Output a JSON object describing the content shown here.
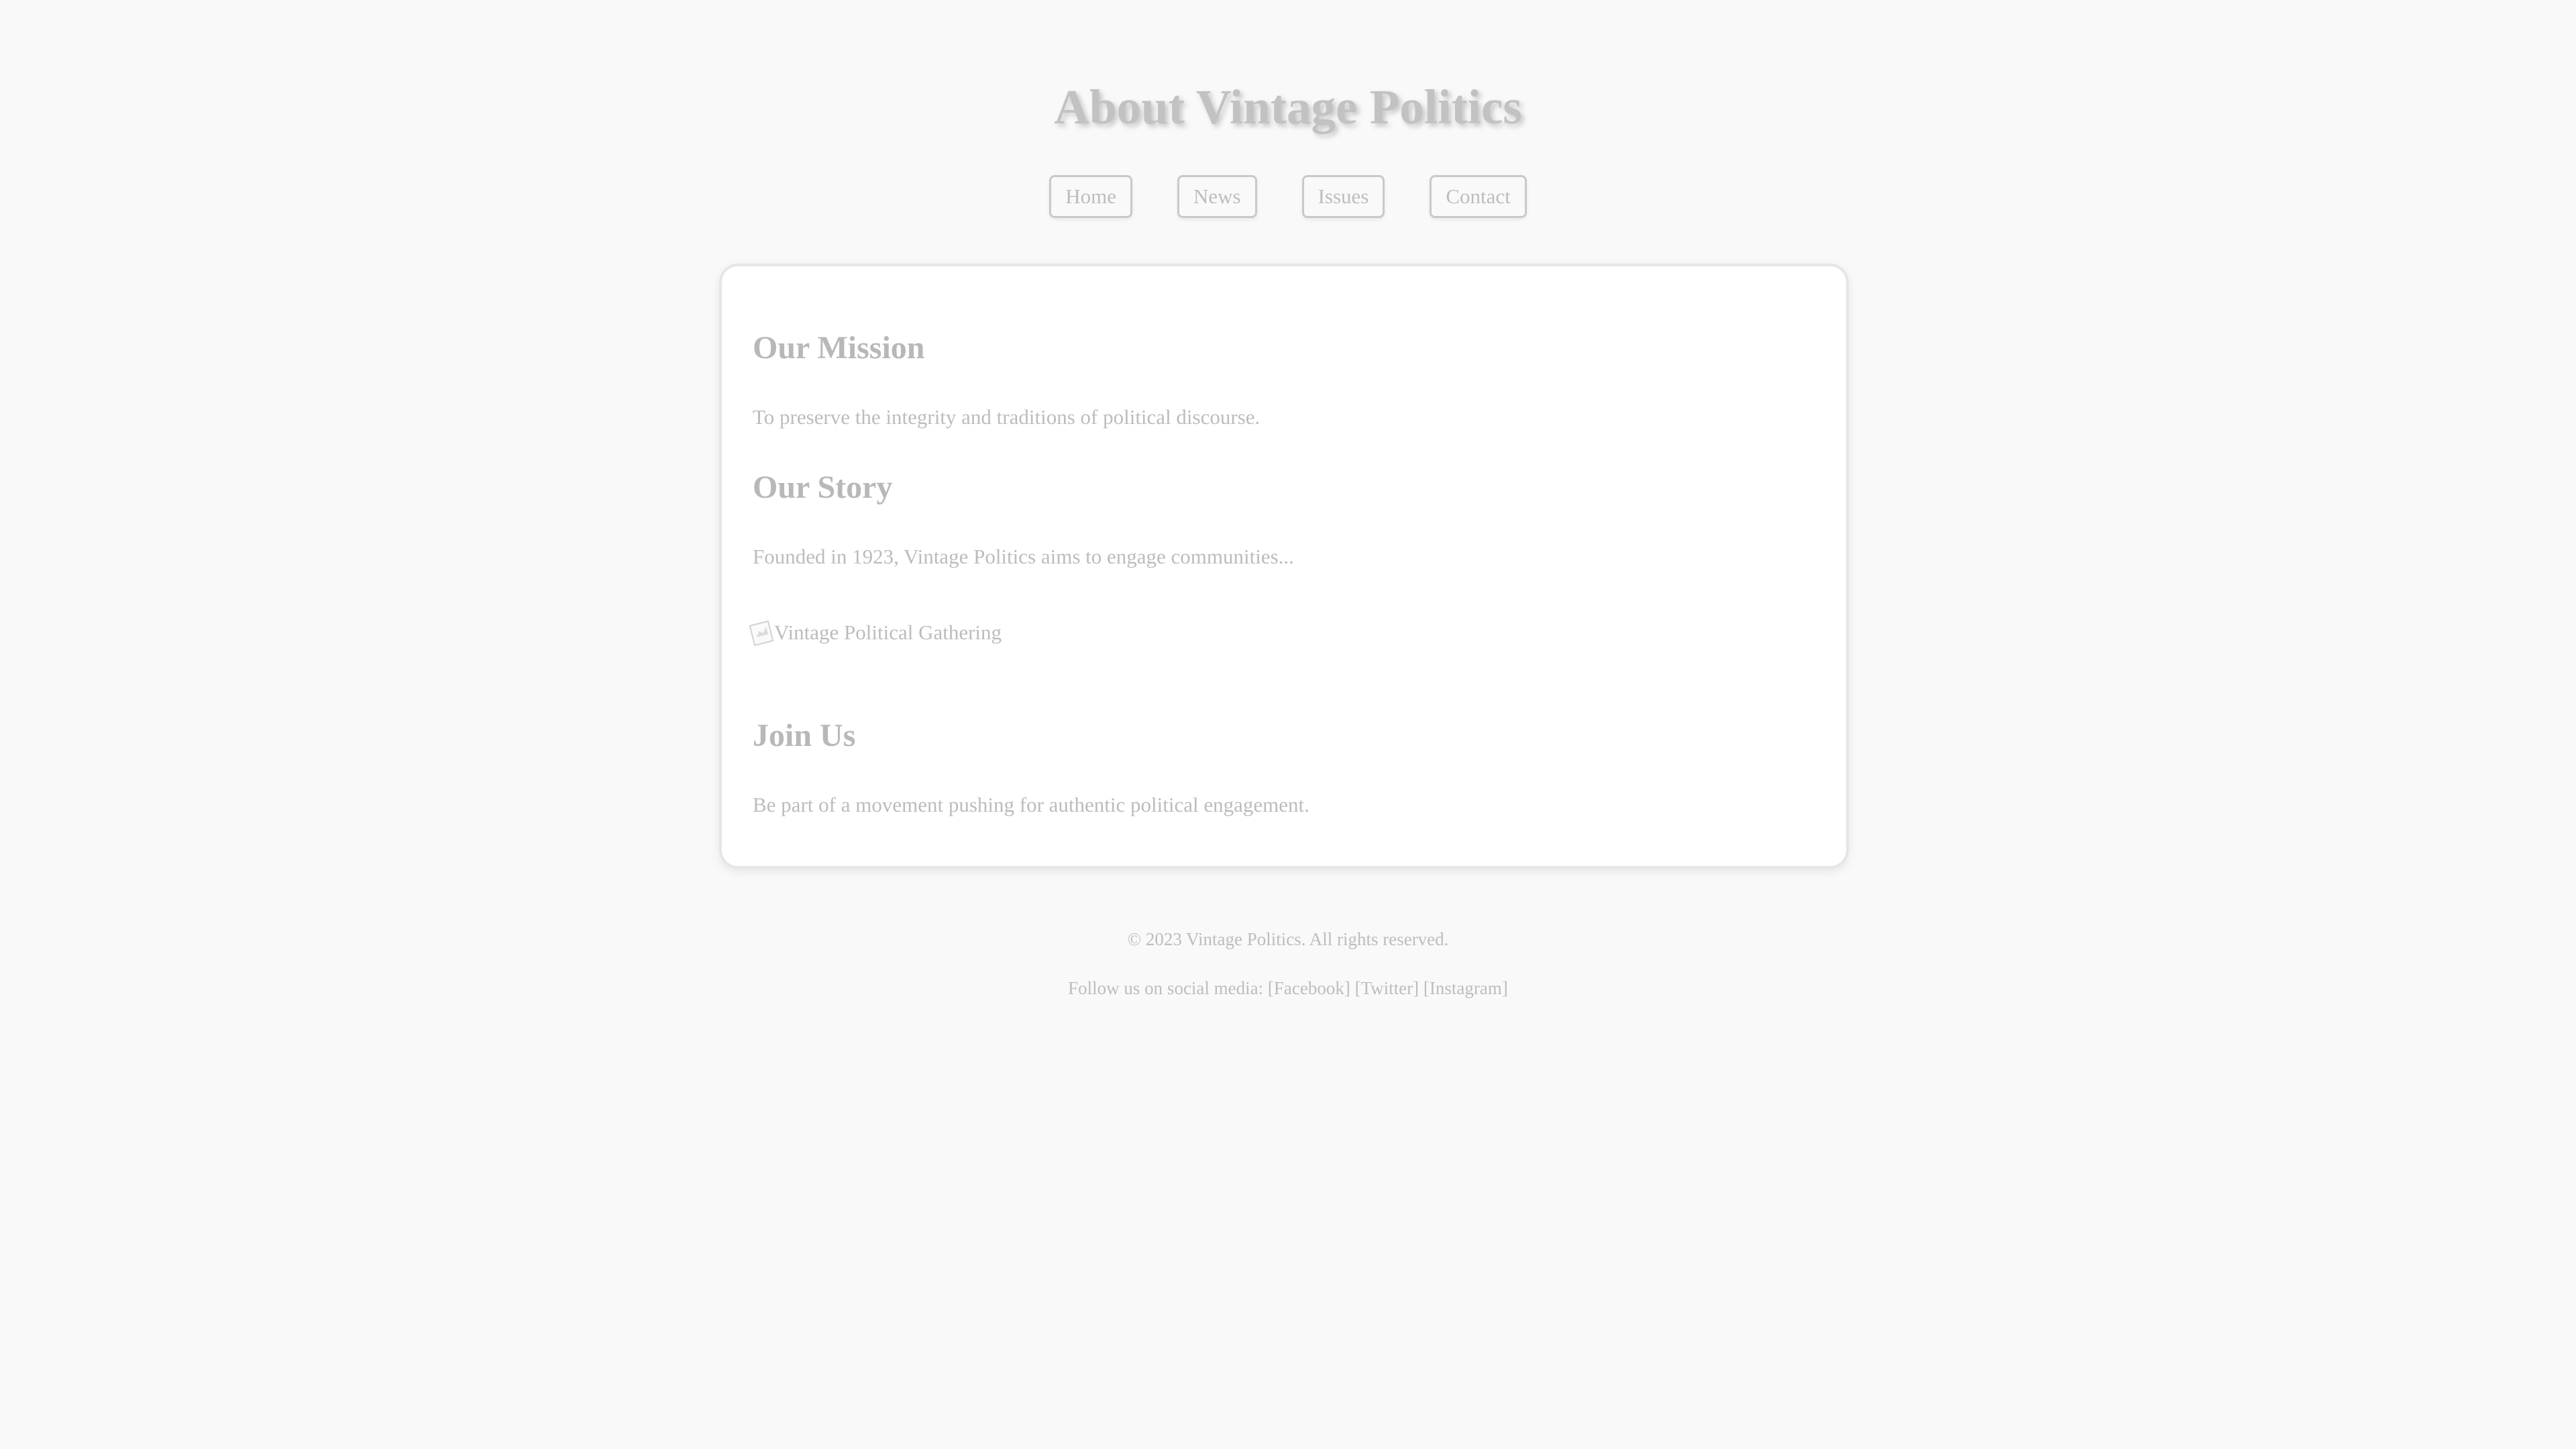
{
  "header": {
    "title": "About Vintage Politics"
  },
  "nav": {
    "items": [
      {
        "label": "Home"
      },
      {
        "label": "News"
      },
      {
        "label": "Issues"
      },
      {
        "label": "Contact"
      }
    ]
  },
  "main": {
    "mission": {
      "heading": "Our Mission",
      "text": "To preserve the integrity and traditions of political discourse."
    },
    "story": {
      "heading": "Our Story",
      "text": "Founded in 1923, Vintage Politics aims to engage communities..."
    },
    "image": {
      "alt": "Vintage Political Gathering",
      "icon": "broken-image-icon"
    },
    "join": {
      "heading": "Join Us",
      "text": "Be part of a movement pushing for authentic political engagement."
    }
  },
  "footer": {
    "copyright": "© 2023 Vintage Politics. All rights reserved.",
    "social": "Follow us on social media: [Facebook] [Twitter] [Instagram]"
  },
  "colors": {
    "background": "#f9f9f9",
    "card": "#ffffff",
    "text": "#b5b5b5",
    "border": "#e6e6e6"
  }
}
